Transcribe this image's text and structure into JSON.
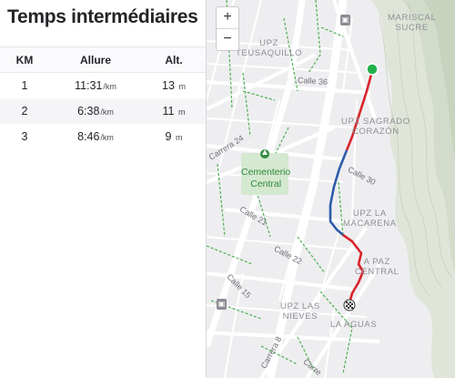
{
  "panel": {
    "title": "Temps intermédiaires",
    "headers": {
      "km": "KM",
      "pace": "Allure",
      "elev": "Alt."
    },
    "rows": [
      {
        "km": "1",
        "pace": "11:31",
        "pace_unit": "/km",
        "elev": "13",
        "elev_unit": "m"
      },
      {
        "km": "2",
        "pace": "6:38",
        "pace_unit": "/km",
        "elev": "11",
        "elev_unit": "m"
      },
      {
        "km": "3",
        "pace": "8:46",
        "pace_unit": "/km",
        "elev": "9",
        "elev_unit": "m"
      }
    ]
  },
  "map": {
    "zoom_in": "+",
    "zoom_out": "−",
    "areas": {
      "mariscal": [
        "MARISCAL",
        "SUCRE"
      ],
      "teusaquillo": [
        "UPZ",
        "TEUSAQUILLO"
      ],
      "sagrado": [
        "UPZ SAGRADO",
        "CORAZÓN"
      ],
      "macarena": [
        "UPZ LA",
        "MACARENA"
      ],
      "lapaz": [
        "A PAZ",
        "CENTRAL"
      ],
      "nieves": [
        "UPZ LAS",
        "NIEVES"
      ],
      "aguas": "LA AGUAS"
    },
    "streets": {
      "calle36": "Calle 36",
      "carrera24": "Carrera 24",
      "calle30": "Calle 30",
      "calle21": "Calle 21",
      "calle22": "Calle 22",
      "calle15": "Calle 15",
      "carrera8": "Carrera 8",
      "carrera7": "Carre"
    },
    "park": [
      "Cementerio",
      "Central"
    ],
    "transit_icon": "transit-bus-icon",
    "colors": {
      "start": "#22b14c",
      "route_fast": "#2d5ca8",
      "route_slow": "#d8232a",
      "park": "#2e8a3e"
    }
  }
}
